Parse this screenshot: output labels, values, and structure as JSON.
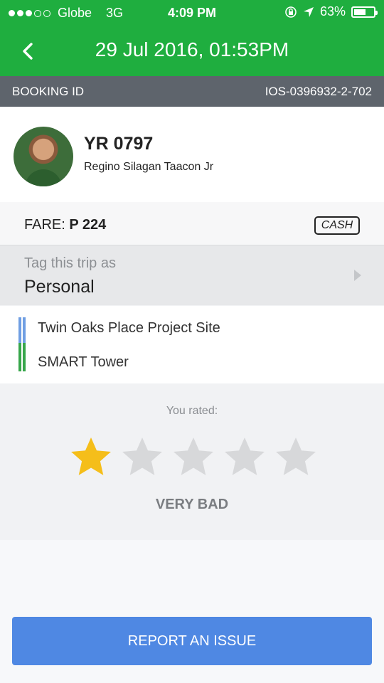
{
  "status_bar": {
    "carrier": "Globe",
    "network": "3G",
    "time": "4:09 PM",
    "battery": "63%",
    "battery_level": 0.63,
    "signal_bars": 3,
    "signal_total": 5
  },
  "header": {
    "title": "29 Jul 2016, 01:53PM",
    "back_icon": "chevron-left-icon",
    "color": "#1fae3f"
  },
  "booking": {
    "label": "BOOKING ID",
    "id": "IOS-0396932-2-702"
  },
  "driver": {
    "plate": "YR 0797",
    "name": "Regino Silagan Taacon Jr"
  },
  "fare": {
    "label": "FARE:",
    "amount": "P 224",
    "payment": "CASH"
  },
  "tag": {
    "hint": "Tag this trip as",
    "value": "Personal"
  },
  "route": {
    "pickup": "Twin Oaks Place Project Site",
    "dropoff": "SMART Tower"
  },
  "rating": {
    "label": "You rated:",
    "value": 1,
    "max": 5,
    "verdict": "VERY BAD",
    "active_color": "#f5be1a",
    "inactive_color": "#d7d8da"
  },
  "actions": {
    "report": "REPORT AN ISSUE"
  }
}
